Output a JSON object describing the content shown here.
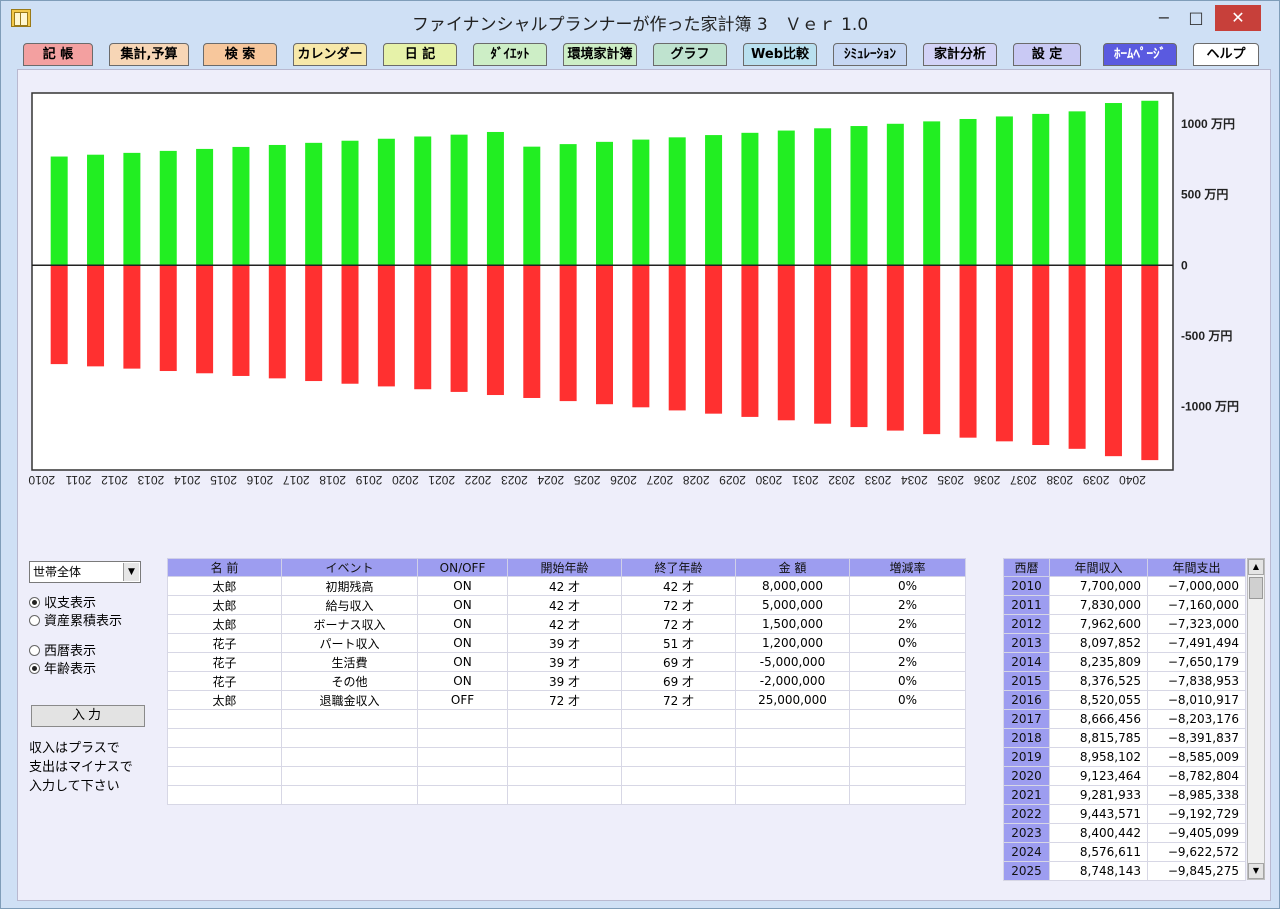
{
  "window": {
    "title": "ファイナンシャルプランナーが作った家計簿 3　Ｖｅｒ 1.0",
    "min_glyph": "−",
    "max_glyph": "□",
    "close_glyph": "✕"
  },
  "menu": [
    {
      "label": "記 帳",
      "bg": "#f3a0a0"
    },
    {
      "label": "集計,予算",
      "bg": "#f7d6b6"
    },
    {
      "label": "検 索",
      "bg": "#f7c79c"
    },
    {
      "label": "カレンダー",
      "bg": "#f7e8a9"
    },
    {
      "label": "日 記",
      "bg": "#e6f2a9"
    },
    {
      "label": "ﾀﾞｲｴｯﾄ",
      "bg": "#cdeec6"
    },
    {
      "label": "環境家計簿",
      "bg": "#cdeec6"
    },
    {
      "label": "グラフ",
      "bg": "#bfe3cf"
    },
    {
      "label": "Web比較",
      "bg": "#b9e0ef"
    },
    {
      "label": "ｼﾐｭﾚｰｼｮﾝ",
      "bg": "#c6d7f3"
    },
    {
      "label": "家計分析",
      "bg": "#d3d3f7"
    },
    {
      "label": "設 定",
      "bg": "#c9c9f4"
    },
    {
      "label": "ﾎｰﾑﾍﾟｰｼﾞ",
      "bg": "#5a5ae0"
    },
    {
      "label": "ヘルプ",
      "bg": "#ffffff"
    }
  ],
  "chart_data": {
    "type": "bar",
    "categories": [
      "2010",
      "2011",
      "2012",
      "2013",
      "2014",
      "2015",
      "2016",
      "2017",
      "2018",
      "2019",
      "2020",
      "2021",
      "2022",
      "2023",
      "2024",
      "2025",
      "2026",
      "2027",
      "2028",
      "2029",
      "2030",
      "2031",
      "2032",
      "2033",
      "2034",
      "2035",
      "2036",
      "2037",
      "2038",
      "2039",
      "2040"
    ],
    "series": [
      {
        "name": "",
        "color": "#22ee22",
        "values": [
          770,
          783,
          796,
          810,
          824,
          838,
          852,
          867,
          882,
          896,
          912,
          925,
          944,
          840,
          858,
          874,
          890,
          906,
          922,
          938,
          954,
          970,
          986,
          1002,
          1019,
          1036,
          1054,
          1072,
          1090,
          1149,
          1165
        ]
      },
      {
        "name": "",
        "color": "#ff3030",
        "values": [
          -700,
          -716,
          -732,
          -749,
          -765,
          -784,
          -801,
          -820,
          -839,
          -858,
          -878,
          -897,
          -919,
          -940,
          -962,
          -984,
          -1006,
          -1028,
          -1051,
          -1074,
          -1098,
          -1122,
          -1146,
          -1171,
          -1196,
          -1221,
          -1247,
          -1273,
          -1300,
          -1352,
          -1380
        ]
      }
    ],
    "ylim": [
      -1450,
      1220
    ],
    "y_ticks": [
      {
        "value": 1000,
        "label": "1000 万円"
      },
      {
        "value": 500,
        "label": "500 万円"
      },
      {
        "value": 0,
        "label": "0"
      },
      {
        "value": -500,
        "label": "-500 万円"
      },
      {
        "value": -1000,
        "label": "-1000 万円"
      }
    ],
    "grid": false,
    "legend": "none"
  },
  "controls": {
    "scope_select": "世帯全体",
    "radio_group_1": [
      {
        "label": "収支表示",
        "checked": true
      },
      {
        "label": "資産累積表示",
        "checked": false
      }
    ],
    "radio_group_2": [
      {
        "label": "西暦表示",
        "checked": false
      },
      {
        "label": "年齢表示",
        "checked": true
      }
    ],
    "input_button": "入力",
    "note": "収入はプラスで\n支出はマイナスで\n入力して下さい"
  },
  "events_table": {
    "headers": [
      "名 前",
      "イベント",
      "ON/OFF",
      "開始年齢",
      "終了年齢",
      "金 額",
      "増減率"
    ],
    "rows": [
      [
        "太郎",
        "初期残高",
        "ON",
        "42 才",
        "42 才",
        "8,000,000",
        "0%"
      ],
      [
        "太郎",
        "給与収入",
        "ON",
        "42 才",
        "72 才",
        "5,000,000",
        "2%"
      ],
      [
        "太郎",
        "ボーナス収入",
        "ON",
        "42 才",
        "72 才",
        "1,500,000",
        "2%"
      ],
      [
        "花子",
        "パート収入",
        "ON",
        "39 才",
        "51 才",
        "1,200,000",
        "0%"
      ],
      [
        "花子",
        "生活費",
        "ON",
        "39 才",
        "69 才",
        "-5,000,000",
        "2%"
      ],
      [
        "花子",
        "その他",
        "ON",
        "39 才",
        "69 才",
        "-2,000,000",
        "0%"
      ],
      [
        "太郎",
        "退職金収入",
        "OFF",
        "72 才",
        "72 才",
        "25,000,000",
        "0%"
      ],
      [
        "",
        "",
        "",
        "",
        "",
        "",
        ""
      ],
      [
        "",
        "",
        "",
        "",
        "",
        "",
        ""
      ],
      [
        "",
        "",
        "",
        "",
        "",
        "",
        ""
      ],
      [
        "",
        "",
        "",
        "",
        "",
        "",
        ""
      ],
      [
        "",
        "",
        "",
        "",
        "",
        "",
        ""
      ]
    ]
  },
  "yearly_table": {
    "headers": [
      "西暦",
      "年間収入",
      "年間支出"
    ],
    "rows": [
      [
        "2010",
        "7,700,000",
        "−7,000,000"
      ],
      [
        "2011",
        "7,830,000",
        "−7,160,000"
      ],
      [
        "2012",
        "7,962,600",
        "−7,323,000"
      ],
      [
        "2013",
        "8,097,852",
        "−7,491,494"
      ],
      [
        "2014",
        "8,235,809",
        "−7,650,179"
      ],
      [
        "2015",
        "8,376,525",
        "−7,838,953"
      ],
      [
        "2016",
        "8,520,055",
        "−8,010,917"
      ],
      [
        "2017",
        "8,666,456",
        "−8,203,176"
      ],
      [
        "2018",
        "8,815,785",
        "−8,391,837"
      ],
      [
        "2019",
        "8,958,102",
        "−8,585,009"
      ],
      [
        "2020",
        "9,123,464",
        "−8,782,804"
      ],
      [
        "2021",
        "9,281,933",
        "−8,985,338"
      ],
      [
        "2022",
        "9,443,571",
        "−9,192,729"
      ],
      [
        "2023",
        "8,400,442",
        "−9,405,099"
      ],
      [
        "2024",
        "8,576,611",
        "−9,622,572"
      ],
      [
        "2025",
        "8,748,143",
        "−9,845,275"
      ]
    ]
  }
}
